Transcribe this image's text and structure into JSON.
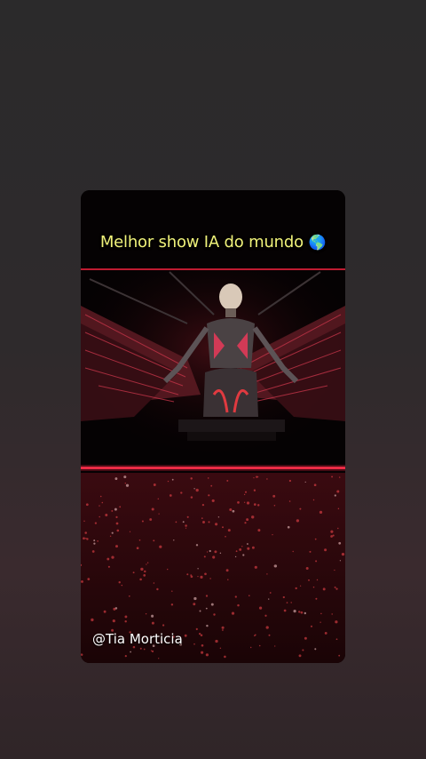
{
  "story": {
    "caption": "Melhor show IA do mundo",
    "caption_emoji": "🌎",
    "handle": "@Tia Morticia"
  },
  "colors": {
    "caption": "#f0f27a",
    "accent_red": "#e0203a",
    "background": "#2b2a2b"
  }
}
